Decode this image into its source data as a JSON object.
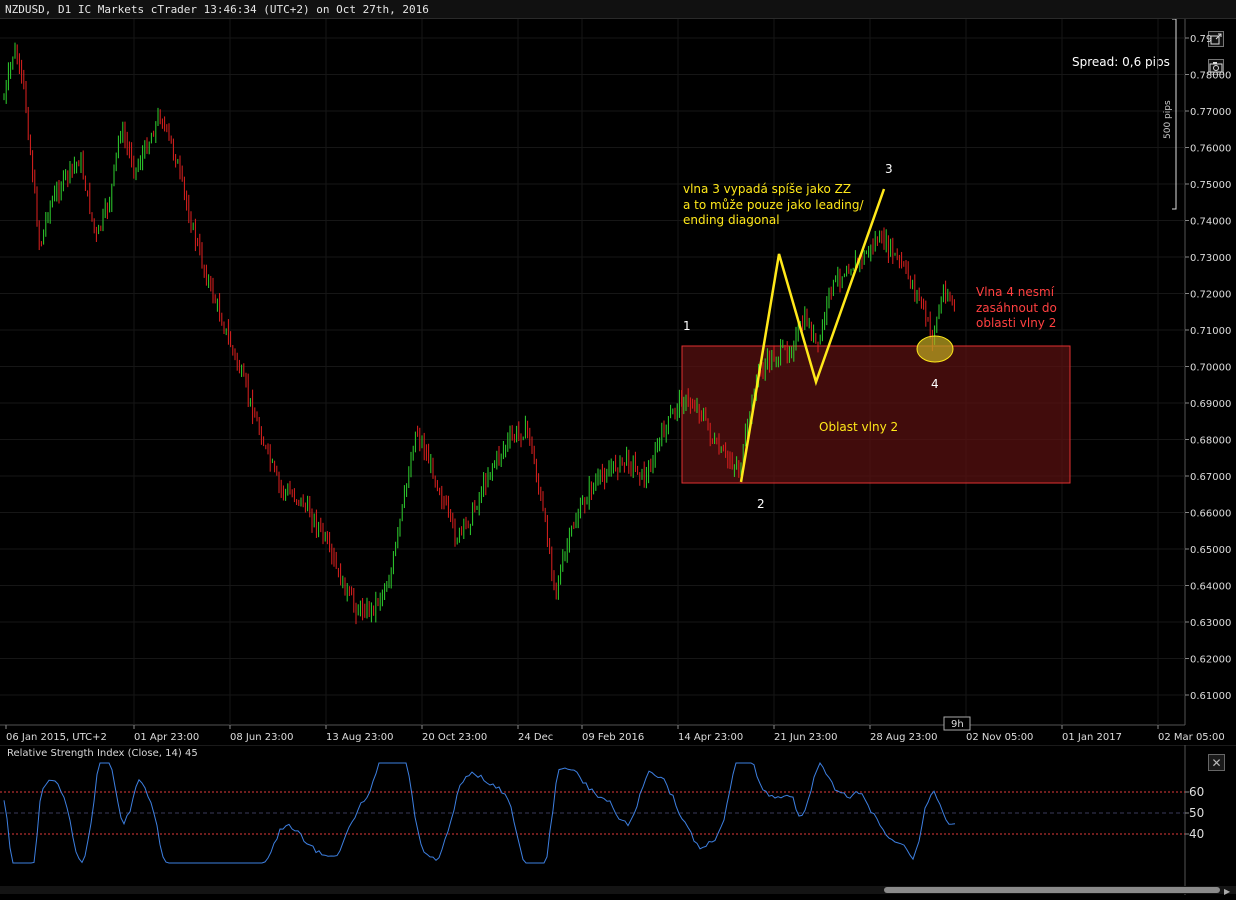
{
  "header": {
    "title": "NZDUSD, D1 IC Markets cTrader 13:46:34 (UTC+2) on Oct 27th, 2016"
  },
  "controls": {
    "expand_icon": "expand-icon",
    "camera_icon": "camera-icon",
    "close_icon": "close-icon"
  },
  "spread": "Spread: 0,6 pips",
  "scale_label": "500 pips",
  "price_axis": [
    "0.79",
    "0.78000",
    "0.77000",
    "0.76000",
    "0.75000",
    "0.74000",
    "0.73000",
    "0.72000",
    "0.71000",
    "0.70000",
    "0.69000",
    "0.68000",
    "0.67000",
    "0.66000",
    "0.65000",
    "0.64000",
    "0.63000",
    "0.62000",
    "0.61000"
  ],
  "time_axis": [
    "06 Jan 2015, UTC+2",
    "01 Apr 23:00",
    "08 Jun 23:00",
    "13 Aug 23:00",
    "20 Oct 23:00",
    "24 Dec",
    "09 Feb 2016",
    "14 Apr 23:00",
    "21 Jun 23:00",
    "28 Aug 23:00",
    "02 Nov 05:00",
    "01 Jan 2017",
    "02 Mar 05:00"
  ],
  "time_marker": "9h",
  "annotations": {
    "wave_labels": [
      "1",
      "2",
      "3",
      "4"
    ],
    "wave3_note": [
      "vlna 3 vypadá spíše jako ZZ",
      "a to může pouze jako leading/",
      "ending diagonal"
    ],
    "wave4_note": [
      "Vlna 4 nesmí",
      "zasáhnout do",
      "oblasti vlny 2"
    ],
    "zone_label": "Oblast vlny 2"
  },
  "rsi": {
    "label": "Relative Strength Index (Close, 14) 45",
    "axis": [
      "60",
      "50",
      "40"
    ],
    "levels": {
      "upper": 60,
      "lower": 40
    }
  },
  "colors": {
    "bull": "#2fd12f",
    "bear": "#e0211f",
    "wave_line": "#ffe81a",
    "zone_fill": "#5a1010",
    "zone_border": "#e03030",
    "rsi_line": "#3d7fe0",
    "note_yellow": "#ffe81a",
    "note_red": "#ff4040"
  }
}
